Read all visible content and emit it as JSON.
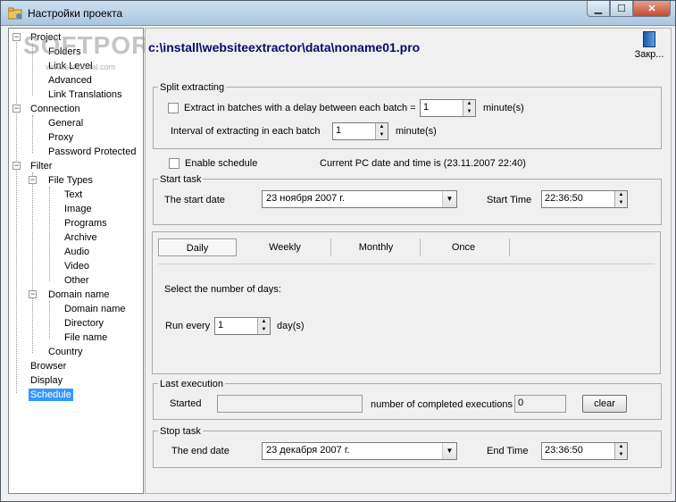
{
  "window": {
    "title": "Настройки проекта"
  },
  "titlebar": {
    "min_icon": "minimize-icon",
    "max_icon": "maximize-icon",
    "close_icon": "close-icon"
  },
  "watermark": {
    "text": "SOFTPORTAL",
    "sub": "www.softportal.com"
  },
  "tree": {
    "project": "Project",
    "folders": "Folders",
    "link_level": "Link Level",
    "advanced": "Advanced",
    "link_translations": "Link Translations",
    "connection": "Connection",
    "general": "General",
    "proxy": "Proxy",
    "password_protected": "Password Protected",
    "filter": "Filter",
    "file_types": "File Types",
    "text": "Text",
    "image": "Image",
    "programs": "Programs",
    "archive": "Archive",
    "audio": "Audio",
    "video": "Video",
    "other": "Other",
    "domain_name": "Domain name",
    "domain_name_item": "Domain name",
    "directory": "Directory",
    "file_name": "File name",
    "country": "Country",
    "browser": "Browser",
    "display": "Display",
    "schedule": "Schedule"
  },
  "header": {
    "path": "c:\\install\\websiteextractor\\data\\noname01.pro",
    "close_label": "Закр..."
  },
  "split": {
    "title": "Split extracting",
    "batch_label": "Extract in batches with a delay between each batch =",
    "batch_value": "1",
    "batch_unit": "minute(s)",
    "interval_label": "Interval of extracting in each batch",
    "interval_value": "1",
    "interval_unit": "minute(s)"
  },
  "schedule": {
    "enable_label": "Enable schedule",
    "current_time": "Current PC date and time is (23.11.2007 22:40)"
  },
  "start_task": {
    "title": "Start task",
    "date_label": "The start date",
    "date_value": "23  ноября  2007 г.",
    "time_label": "Start Time",
    "time_value": "22:36:50"
  },
  "tabs": {
    "daily": "Daily",
    "weekly": "Weekly",
    "monthly": "Monthly",
    "once": "Once",
    "select_days": "Select the number of days:",
    "run_every_label": "Run every",
    "run_every_value": "1",
    "run_every_unit": "day(s)"
  },
  "last_exec": {
    "title": "Last execution",
    "started_label": "Started",
    "started_value": "",
    "completed_label": "number of completed executions",
    "completed_value": "0",
    "clear_label": "clear"
  },
  "stop_task": {
    "title": "Stop task",
    "date_label": "The end date",
    "date_value": "23 декабря  2007 г.",
    "time_label": "End Time",
    "time_value": "23:36:50"
  }
}
